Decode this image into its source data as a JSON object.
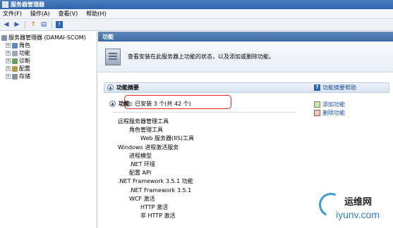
{
  "window": {
    "title": "服务器管理器"
  },
  "menu": [
    {
      "label": "文件(F)"
    },
    {
      "label": "操作(A)"
    },
    {
      "label": "查看(V)"
    },
    {
      "label": "帮助(H)"
    }
  ],
  "toolbar": {
    "back_icon": "back-arrow-icon",
    "forward_icon": "forward-arrow-icon",
    "help_label": "?"
  },
  "tree": {
    "root": "服务器管理器 (DAMAI-SCOM)",
    "items": [
      {
        "label": "角色",
        "expander": "+"
      },
      {
        "label": "功能",
        "expander": "+"
      },
      {
        "label": "诊断",
        "expander": "+"
      },
      {
        "label": "配置",
        "expander": "+"
      },
      {
        "label": "存储",
        "expander": "+"
      }
    ]
  },
  "main": {
    "header": "功能",
    "intro": "查看安装在此服务器上功能的状态，以及添加或删除功能。",
    "section_title": "功能摘要",
    "help_link": "功能摘要帮助",
    "features_label": "功能:",
    "features_status": "已安装 3 个(共 42 个)",
    "actions": [
      {
        "label": "添加功能"
      },
      {
        "label": "删除功能"
      }
    ],
    "feature_list": [
      {
        "label": "远程服务器管理工具",
        "level": 0
      },
      {
        "label": "角色管理工具",
        "level": 1
      },
      {
        "label": "Web 服务器(IIS)工具",
        "level": 2
      },
      {
        "label": "Windows 进程激活服务",
        "level": 0
      },
      {
        "label": "进程模型",
        "level": 1
      },
      {
        "label": ".NET 环境",
        "level": 1
      },
      {
        "label": "配置 API",
        "level": 1
      },
      {
        "label": ".NET Framework 3.5.1 功能",
        "level": 0
      },
      {
        "label": ".NET Framework 3.5.1",
        "level": 1
      },
      {
        "label": "WCF 激活",
        "level": 1
      },
      {
        "label": "HTTP 激活",
        "level": 2
      },
      {
        "label": "非 HTTP 激活",
        "level": 2
      }
    ]
  },
  "watermark": {
    "line1": "运维网",
    "line2": "iyunv.com"
  }
}
